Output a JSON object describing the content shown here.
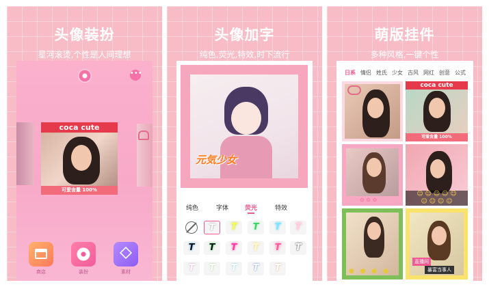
{
  "colors": {
    "panel_bg": "#f8bcc6",
    "accent_pink": "#f05a92",
    "label_red": "#e43a4c"
  },
  "panel1": {
    "title": "头像装扮",
    "subtitle": "星河滚烫,个性是人间理想",
    "menu_icon": "more-horizontal-icon",
    "logo_icon": "donut-icon",
    "card": {
      "banner": "coca cute",
      "caption": "可爱含量 100%"
    },
    "tools": [
      {
        "label": "商店",
        "icon": "shop-icon"
      },
      {
        "label": "装扮",
        "icon": "donut-icon"
      },
      {
        "label": "素材",
        "icon": "layers-icon"
      }
    ]
  },
  "panel2": {
    "title": "头像加字",
    "subtitle": "纯色,荧光,特效,时下流行",
    "photo_text": "元気少女",
    "tabs": [
      "纯色",
      "字体",
      "荧光",
      "特效"
    ],
    "active_tab": "荧光",
    "fx_glyph": "T"
  },
  "panel3": {
    "title": "萌版挂件",
    "subtitle": "多种风格,一键个性",
    "categories": [
      "日系",
      "情侣",
      "姓氏",
      "少女",
      "古风",
      "网红",
      "创意",
      "公式"
    ],
    "active_category": "日系",
    "banner": "coca cute",
    "caption": "可爱含量 100%",
    "tag": "直播间",
    "name_tag": "暴富当事人"
  }
}
